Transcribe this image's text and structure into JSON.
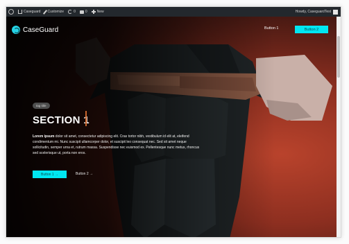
{
  "adminbar": {
    "site_name": "Caseguard",
    "customize": "Customize",
    "updates": "0",
    "comments": "0",
    "new": "New",
    "greeting": "Howdy, CaseguardTest"
  },
  "header": {
    "brand": "CaseGuard",
    "button1": "Button 1",
    "button2": "Button 2"
  },
  "hero": {
    "tag": "tag title",
    "title": "SECTION 1",
    "desc_lead": "Lorem ipsum",
    "desc_body": " dolor sit amet, consectetur adipiscing elit. Cras tortor nibh, vestibulum id elit at, eleifend condimentum mi. Nunc suscipit ullamcorper dolor, et suscipit leo consequat nec. Sed sit amet neque sollicitudin, semper urna et, rutrum massa. Suspendisse nec euismod ex. Pellentesque nunc metus, rhoncus sed scelerisque ut, porta non eros.",
    "cta1": "Button 1 →",
    "cta2": "Button 2 →"
  },
  "colors": {
    "accent": "#00e7f2",
    "title_bar": "#c8642c",
    "adminbar_bg": "#23282d"
  }
}
